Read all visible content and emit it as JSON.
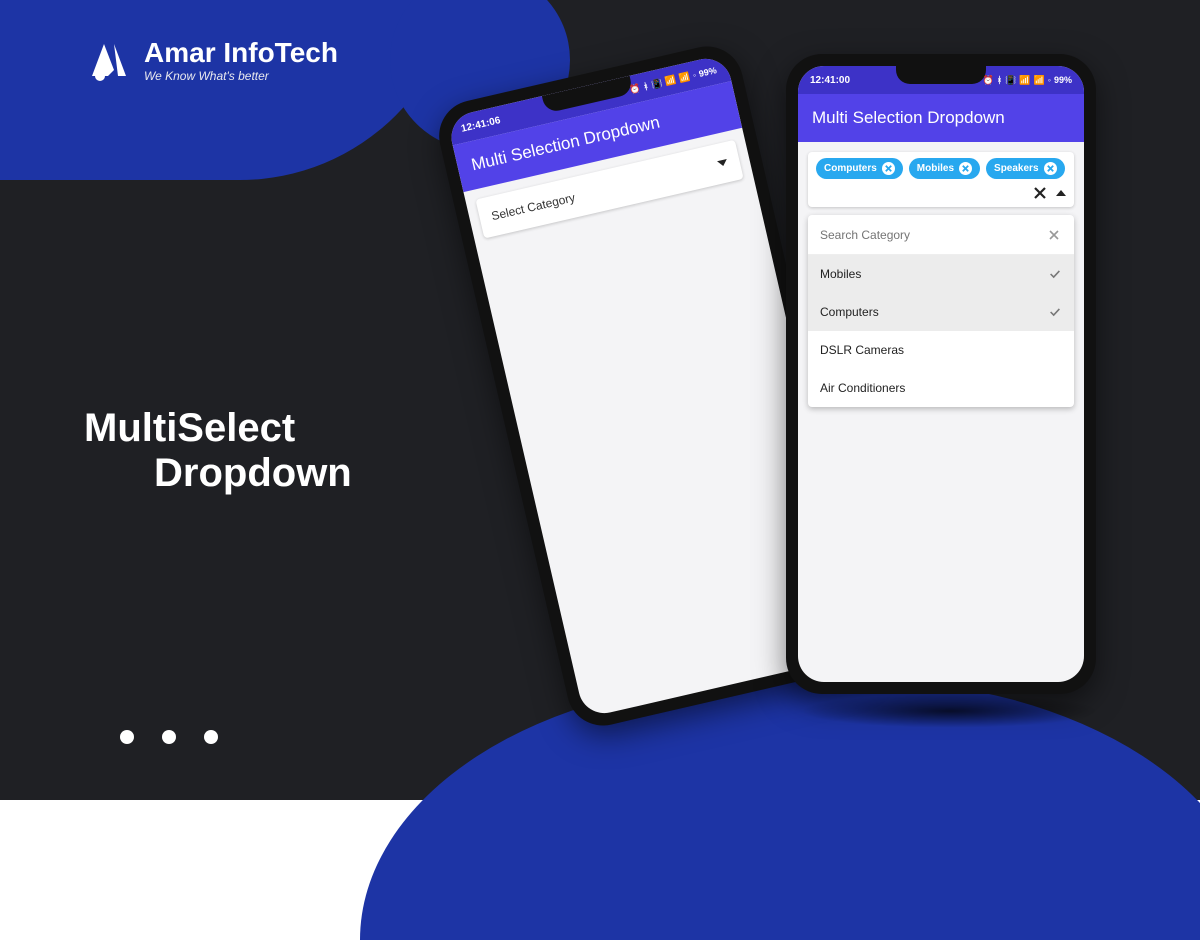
{
  "brand": {
    "name_bold": "Amar",
    "name_light": "InfoTech",
    "tagline": "We Know What's better"
  },
  "marketing": {
    "line1": "MultiSelect",
    "line2": "Dropdown"
  },
  "phone_closed": {
    "status": {
      "time": "12:41:06",
      "battery": "99%"
    },
    "app_title": "Multi Selection Dropdown",
    "placeholder": "Select Category"
  },
  "phone_open": {
    "status": {
      "time": "12:41:00",
      "battery": "99%"
    },
    "app_title": "Multi Selection Dropdown",
    "chips": [
      {
        "label": "Computers"
      },
      {
        "label": "Mobiles"
      },
      {
        "label": "Speakers"
      }
    ],
    "search_placeholder": "Search Category",
    "options": [
      {
        "label": "Mobiles",
        "selected": true
      },
      {
        "label": "Computers",
        "selected": true
      },
      {
        "label": "DSLR Cameras",
        "selected": false
      },
      {
        "label": "Air Conditioners",
        "selected": false
      }
    ]
  },
  "colors": {
    "bg": "#1f2024",
    "blue": "#1d34a5",
    "appbar": "#5242e8",
    "chip": "#28a8ef"
  }
}
